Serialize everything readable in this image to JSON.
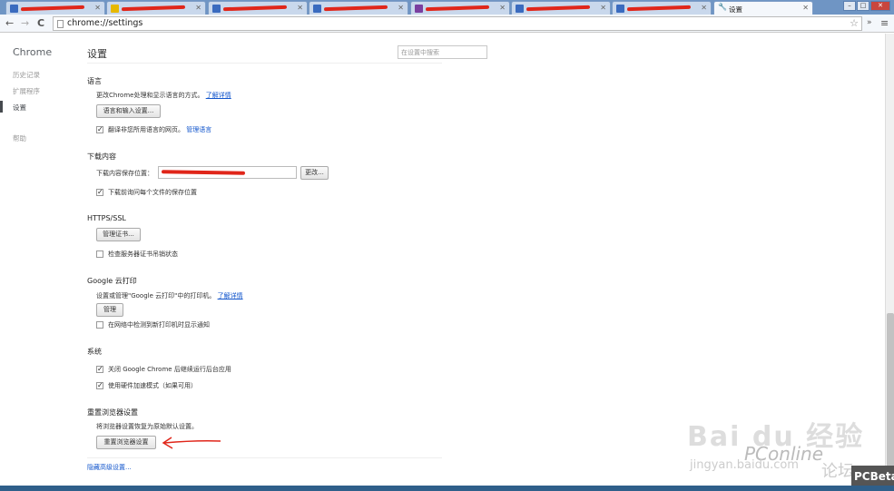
{
  "browser": {
    "active_tab_title": "设置",
    "url": "chrome://settings",
    "nav": {
      "back": "←",
      "forward": "→",
      "reload": "C"
    }
  },
  "sidebar": {
    "title": "Chrome",
    "items": [
      {
        "label": "历史记录"
      },
      {
        "label": "扩展程序"
      },
      {
        "label": "设置"
      },
      {
        "label": "帮助"
      }
    ]
  },
  "main": {
    "title": "设置",
    "search_placeholder": "在设置中搜索",
    "language": {
      "heading": "语言",
      "desc": "更改Chrome处理和显示语言的方式。",
      "learn_more": "了解详情",
      "button": "语言和输入设置...",
      "translate_label": "翻译非您所用语言的网页。",
      "manage_languages": "管理语言"
    },
    "downloads": {
      "heading": "下载内容",
      "location_label": "下载内容保存位置：",
      "change_button": "更改...",
      "ask_label": "下载前询问每个文件的保存位置"
    },
    "https": {
      "heading": "HTTPS/SSL",
      "button": "管理证书...",
      "revocation_label": "检查服务器证书吊销状态"
    },
    "cloudprint": {
      "heading": "Google 云打印",
      "desc": "设置或管理\"Google 云打印\"中的打印机。",
      "learn_more": "了解详情",
      "button": "管理",
      "notify_label": "在网络中检测到新打印机时显示通知"
    },
    "system": {
      "heading": "系统",
      "background_label": "关闭 Google Chrome 后继续运行后台应用",
      "hw_accel_label": "使用硬件加速模式（如果可用）"
    },
    "reset": {
      "heading": "重置浏览器设置",
      "desc": "将浏览器设置恢复为原始默认设置。",
      "button": "重置浏览器设置"
    },
    "hide_advanced": "隐藏高级设置..."
  },
  "watermark": {
    "baidu": "Bai du 经验",
    "url": "jingyan.baidu.com",
    "pconline": "PConline",
    "forum": "论坛",
    "pcbeta": "PCBeta"
  },
  "colors": {
    "link": "#1155cc",
    "annotation_arrow": "#e0261a"
  }
}
